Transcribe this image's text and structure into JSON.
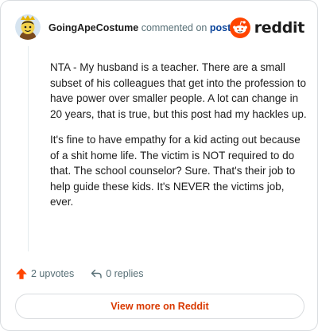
{
  "header": {
    "author": "GoingApeCostume",
    "action_text": "commented on",
    "post_link": "post",
    "brand": "reddit"
  },
  "comment": {
    "paragraphs": [
      "NTA - My husband is a teacher. There are a small subset of his colleagues that get into the profession to have power over smaller people. A lot can change in 20 years, that is true, but this post had my hackles up.",
      "It's fine to have empathy for a kid acting out because of a shit home life. The victim is NOT required to do that. The school counselor? Sure. That's their job to help guide these kids. It's NEVER the victims job, ever."
    ]
  },
  "actions": {
    "upvotes": "2 upvotes",
    "replies": "0 replies"
  },
  "footer": {
    "view_more": "View more on Reddit"
  },
  "colors": {
    "brand_orange": "#ff4500",
    "link_blue": "#0a449b",
    "cta_orange": "#d93900"
  },
  "icons": [
    "avatar",
    "reddit-logo-icon",
    "upvote-arrow-icon",
    "reply-icon"
  ]
}
